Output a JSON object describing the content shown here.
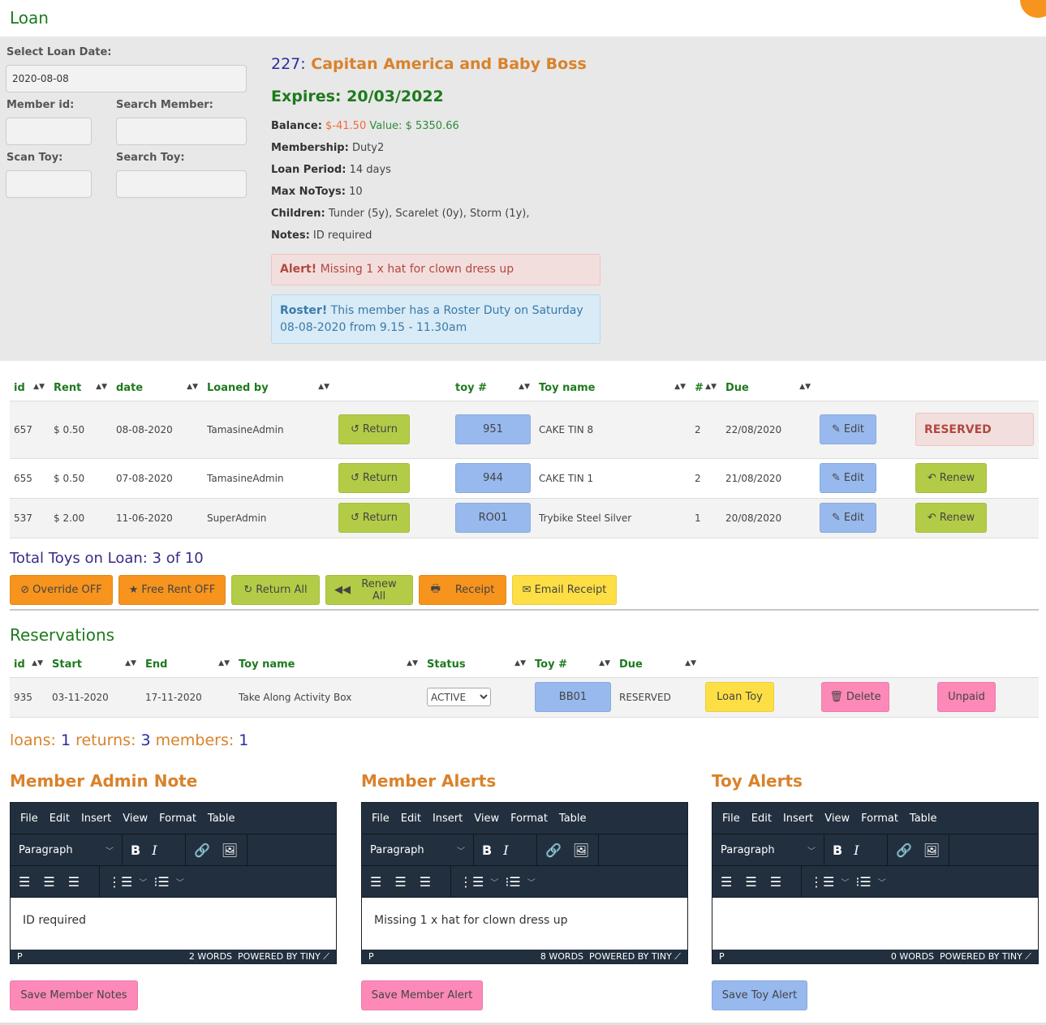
{
  "page": {
    "title": "Loan"
  },
  "form": {
    "loan_date_label": "Select Loan Date:",
    "loan_date_value": "2020-08-08",
    "member_id_label": "Member id:",
    "member_id_value": "",
    "search_member_label": "Search Member:",
    "search_member_value": "",
    "scan_toy_label": "Scan Toy:",
    "scan_toy_value": "",
    "search_toy_label": "Search Toy:",
    "search_toy_value": ""
  },
  "member": {
    "id": "227:",
    "name": "Capitan America and Baby Boss",
    "expires": "Expires: 20/03/2022",
    "balance_label": "Balance:",
    "balance_value": "$-41.50",
    "value_text": "Value: $ 5350.66",
    "membership_label": "Membership:",
    "membership_value": "Duty2",
    "loan_period_label": "Loan Period:",
    "loan_period_value": "14 days",
    "max_toys_label": "Max NoToys:",
    "max_toys_value": "10",
    "children_label": "Children:",
    "children_value": "Tunder (5y), Scarelet (0y), Storm (1y),",
    "notes_label": "Notes:",
    "notes_value": "ID required",
    "alert_label": "Alert!",
    "alert_text": "Missing 1 x hat for clown dress up",
    "roster_label": "Roster!",
    "roster_text": "This member has a Roster Duty on Saturday 08-08-2020 from 9.15 - 11.30am"
  },
  "loans_table": {
    "headers": [
      "id",
      "Rent",
      "date",
      "Loaned by",
      "",
      "toy #",
      "Toy name",
      "#",
      "Due"
    ],
    "rows": [
      {
        "id": "657",
        "rent": "$ 0.50",
        "date": "08-08-2020",
        "loaned_by": "TamasineAdmin",
        "return_label": "Return",
        "toy_no": "951",
        "toy_name": "CAKE TIN 8",
        "qty": "2",
        "due": "22/08/2020",
        "edit_label": "Edit",
        "status": "RESERVED"
      },
      {
        "id": "655",
        "rent": "$ 0.50",
        "date": "07-08-2020",
        "loaned_by": "TamasineAdmin",
        "return_label": "Return",
        "toy_no": "944",
        "toy_name": "CAKE TIN 1",
        "qty": "2",
        "due": "21/08/2020",
        "edit_label": "Edit",
        "renew_label": "Renew"
      },
      {
        "id": "537",
        "rent": "$ 2.00",
        "date": "11-06-2020",
        "loaned_by": "SuperAdmin",
        "return_label": "Return",
        "toy_no": "RO01",
        "toy_name": "Trybike Steel Silver",
        "qty": "1",
        "due": "20/08/2020",
        "edit_label": "Edit",
        "renew_label": "Renew"
      }
    ]
  },
  "totals": {
    "text": "Total Toys on Loan: 3 of 10"
  },
  "actions": {
    "override": "Override OFF",
    "free_rent": "Free Rent OFF",
    "return_all": "Return All",
    "renew_all": "Renew All",
    "receipt": "Receipt",
    "email_receipt": "Email Receipt"
  },
  "reservations": {
    "title": "Reservations",
    "headers": [
      "id",
      "Start",
      "End",
      "Toy name",
      "Status",
      "Toy #",
      "Due"
    ],
    "rows": [
      {
        "id": "935",
        "start": "03-11-2020",
        "end": "17-11-2020",
        "toy_name": "Take Along Activity Box",
        "status": "ACTIVE",
        "toy_no": "BB01",
        "due": "RESERVED",
        "loan_label": "Loan Toy",
        "delete_label": "Delete",
        "unpaid_label": "Unpaid"
      }
    ]
  },
  "stats": {
    "loans_label": "loans:",
    "loans": "1",
    "returns_label": "returns:",
    "returns": "3",
    "members_label": "members:",
    "members": "1"
  },
  "editor_menu": [
    "File",
    "Edit",
    "Insert",
    "View",
    "Format",
    "Table"
  ],
  "editor_block_format": "Paragraph",
  "editors": [
    {
      "title": "Member Admin Note",
      "content": "ID required",
      "path": "P",
      "words": "2 WORDS",
      "powered": "POWERED BY TINY",
      "save_label": "Save Member Notes"
    },
    {
      "title": "Member Alerts",
      "content": "Missing 1 x hat for clown dress up",
      "path": "P",
      "words": "8 WORDS",
      "powered": "POWERED BY TINY",
      "save_label": "Save Member Alert"
    },
    {
      "title": "Toy Alerts",
      "content": "",
      "path": "P",
      "words": "0 WORDS",
      "powered": "POWERED BY TINY",
      "save_label": "Save Toy Alert"
    }
  ]
}
